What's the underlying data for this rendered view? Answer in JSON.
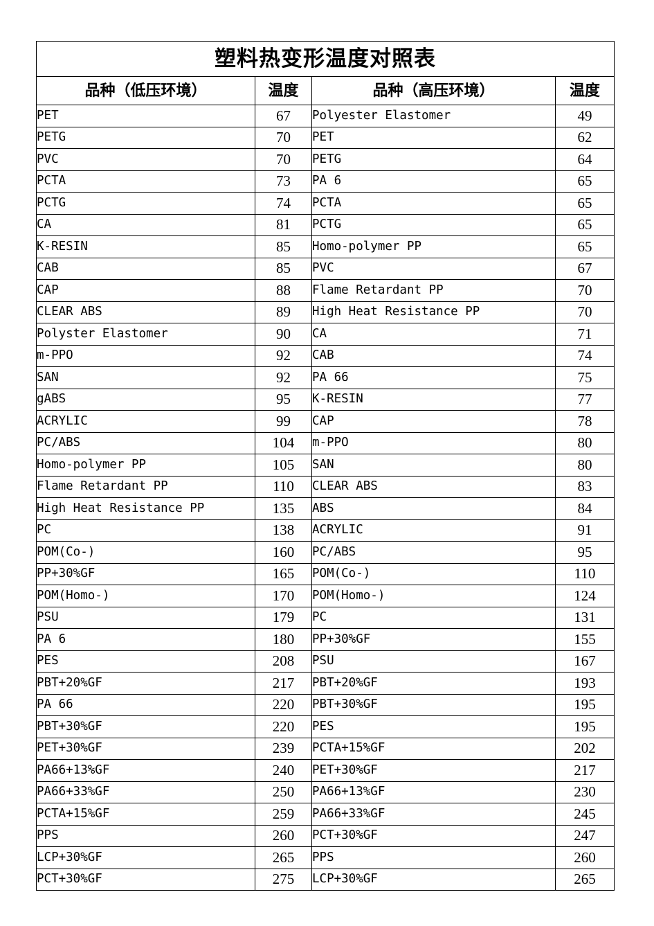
{
  "document": {
    "title": "塑料热变形温度对照表",
    "headers": {
      "name_low": "品种（低压环境）",
      "temp_low": "温度",
      "name_high": "品种（高压环境）",
      "temp_high": "温度"
    },
    "highlight_color": "#CCFFFF",
    "border_color": "#000000",
    "rows": [
      {
        "left_name": "PET",
        "left_temp": "67",
        "left_hl": false,
        "right_name": "Polyester Elastomer",
        "right_temp": "49",
        "right_hl": false
      },
      {
        "left_name": "PETG",
        "left_temp": "70",
        "left_hl": false,
        "right_name": "PET",
        "right_temp": "62",
        "right_hl": false
      },
      {
        "left_name": "PVC",
        "left_temp": "70",
        "left_hl": true,
        "right_name": "PETG",
        "right_temp": "64",
        "right_hl": false
      },
      {
        "left_name": "PCTA",
        "left_temp": "73",
        "left_hl": false,
        "right_name": "PA 6",
        "right_temp": "65",
        "right_hl": true
      },
      {
        "left_name": "PCTG",
        "left_temp": "74",
        "left_hl": false,
        "right_name": "PCTA",
        "right_temp": "65",
        "right_hl": false
      },
      {
        "left_name": "CA",
        "left_temp": "81",
        "left_hl": false,
        "right_name": "PCTG",
        "right_temp": "65",
        "right_hl": false
      },
      {
        "left_name": "K-RESIN",
        "left_temp": "85",
        "left_hl": false,
        "right_name": "Homo-polymer PP",
        "right_temp": "65",
        "right_hl": false
      },
      {
        "left_name": "CAB",
        "left_temp": "85",
        "left_hl": false,
        "right_name": "PVC",
        "right_temp": "67",
        "right_hl": true
      },
      {
        "left_name": "CAP",
        "left_temp": "88",
        "left_hl": false,
        "right_name": "Flame Retardant PP",
        "right_temp": "70",
        "right_hl": false
      },
      {
        "left_name": "CLEAR ABS",
        "left_temp": "89",
        "left_hl": true,
        "right_name": "High Heat Resistance PP",
        "right_temp": "70",
        "right_hl": false
      },
      {
        "left_name": "Polyster Elastomer",
        "left_temp": "90",
        "left_hl": false,
        "right_name": "CA",
        "right_temp": "71",
        "right_hl": false
      },
      {
        "left_name": "m-PPO",
        "left_temp": "92",
        "left_hl": false,
        "right_name": "CAB",
        "right_temp": "74",
        "right_hl": false
      },
      {
        "left_name": "SAN",
        "left_temp": "92",
        "left_hl": false,
        "right_name": "PA 66",
        "right_temp": "75",
        "right_hl": true
      },
      {
        "left_name": "gABS",
        "left_temp": "95",
        "left_hl": false,
        "right_name": "K-RESIN",
        "right_temp": "77",
        "right_hl": false
      },
      {
        "left_name": "ACRYLIC",
        "left_temp": "99",
        "left_hl": false,
        "right_name": "CAP",
        "right_temp": "78",
        "right_hl": false
      },
      {
        "left_name": "PC/ABS",
        "left_temp": "104",
        "left_hl": true,
        "right_name": "m-PPO",
        "right_temp": "80",
        "right_hl": false
      },
      {
        "left_name": "Homo-polymer PP",
        "left_temp": "105",
        "left_hl": false,
        "right_name": "SAN",
        "right_temp": "80",
        "right_hl": false
      },
      {
        "left_name": "Flame Retardant PP",
        "left_temp": "110",
        "left_hl": false,
        "right_name": "CLEAR ABS",
        "right_temp": "83",
        "right_hl": false
      },
      {
        "left_name": "High Heat Resistance PP",
        "left_temp": "135",
        "left_hl": false,
        "right_name": "ABS",
        "right_temp": "84",
        "right_hl": true
      },
      {
        "left_name": "PC",
        "left_temp": "138",
        "left_hl": false,
        "right_name": "ACRYLIC",
        "right_temp": "91",
        "right_hl": false
      },
      {
        "left_name": "POM(Co-)",
        "left_temp": "160",
        "left_hl": false,
        "right_name": "PC/ABS",
        "right_temp": "95",
        "right_hl": true
      },
      {
        "left_name": "PP+30%GF",
        "left_temp": "165",
        "left_hl": false,
        "right_name": "POM(Co-)",
        "right_temp": "110",
        "right_hl": false
      },
      {
        "left_name": "POM(Homo-)",
        "left_temp": "170",
        "left_hl": false,
        "right_name": "POM(Homo-)",
        "right_temp": "124",
        "right_hl": false
      },
      {
        "left_name": "PSU",
        "left_temp": "179",
        "left_hl": false,
        "right_name": "PC",
        "right_temp": "131",
        "right_hl": true
      },
      {
        "left_name": "PA 6",
        "left_temp": "180",
        "left_hl": true,
        "right_name": "PP+30%GF",
        "right_temp": "155",
        "right_hl": true
      },
      {
        "left_name": "PES",
        "left_temp": "208",
        "left_hl": false,
        "right_name": "PSU",
        "right_temp": "167",
        "right_hl": false
      },
      {
        "left_name": "PBT+20%GF",
        "left_temp": "217",
        "left_hl": false,
        "right_name": "PBT+20%GF",
        "right_temp": "193",
        "right_hl": false
      },
      {
        "left_name": "PA 66",
        "left_temp": "220",
        "left_hl": true,
        "right_name": "PBT+30%GF",
        "right_temp": "195",
        "right_hl": false
      },
      {
        "left_name": "PBT+30%GF",
        "left_temp": "220",
        "left_hl": false,
        "right_name": "PES",
        "right_temp": "195",
        "right_hl": false
      },
      {
        "left_name": "PET+30%GF",
        "left_temp": "239",
        "left_hl": false,
        "right_name": "PCTA+15%GF",
        "right_temp": "202",
        "right_hl": false
      },
      {
        "left_name": "PA66+13%GF",
        "left_temp": "240",
        "left_hl": true,
        "right_name": "PET+30%GF",
        "right_temp": "217",
        "right_hl": false
      },
      {
        "left_name": "PA66+33%GF",
        "left_temp": "250",
        "left_hl": true,
        "right_name": "PA66+13%GF",
        "right_temp": "230",
        "right_hl": true
      },
      {
        "left_name": "PCTA+15%GF",
        "left_temp": "259",
        "left_hl": false,
        "right_name": "PA66+33%GF",
        "right_temp": "245",
        "right_hl": true
      },
      {
        "left_name": "PPS",
        "left_temp": "260",
        "left_hl": false,
        "right_name": "PCT+30%GF",
        "right_temp": "247",
        "right_hl": false
      },
      {
        "left_name": "LCP+30%GF",
        "left_temp": "265",
        "left_hl": false,
        "right_name": "PPS",
        "right_temp": "260",
        "right_hl": false
      },
      {
        "left_name": "PCT+30%GF",
        "left_temp": "275",
        "left_hl": false,
        "right_name": "LCP+30%GF",
        "right_temp": "265",
        "right_hl": false
      }
    ]
  }
}
